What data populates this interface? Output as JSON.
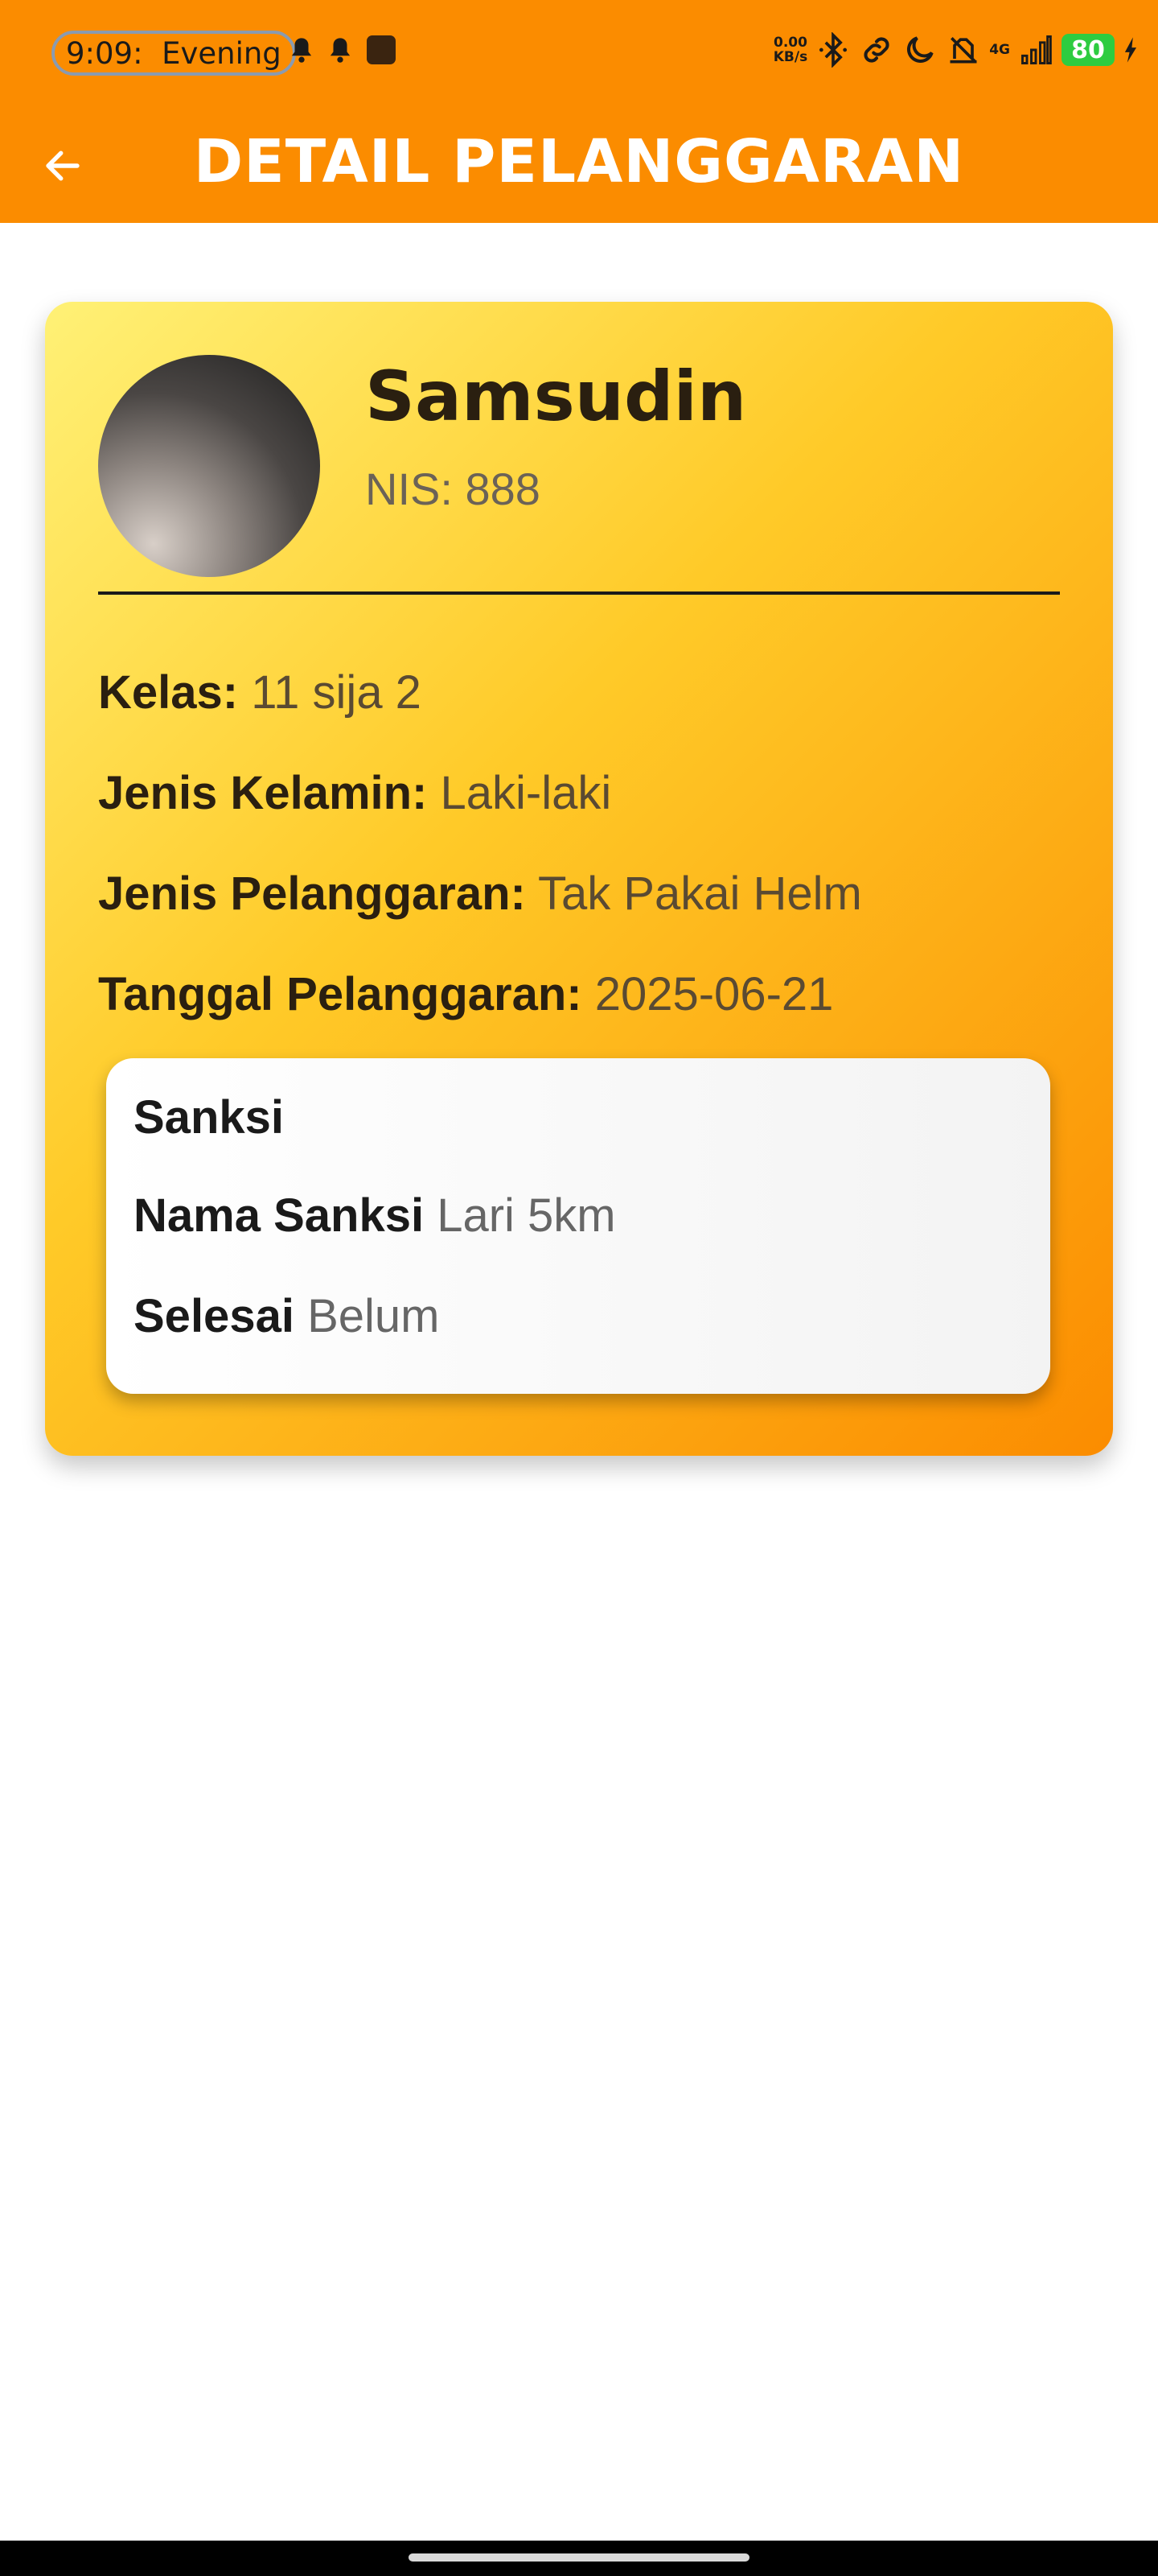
{
  "status_bar": {
    "time": "9:09:",
    "time_label": "Evening",
    "net_speed_top": "0.00",
    "net_speed_bottom": "KB/s",
    "network_type": "4G",
    "battery": "80",
    "icons": [
      "bell-icon",
      "bell-icon",
      "app-icon",
      "bluetooth-icon",
      "link-icon",
      "moon-icon",
      "vibrate-off-icon",
      "signal-icon",
      "battery-icon",
      "charging-icon"
    ]
  },
  "appbar": {
    "title": "DETAIL PELANGGARAN",
    "back_icon": "arrow-left-icon",
    "background": "#fb8c00"
  },
  "student": {
    "name": "Samsudin",
    "nis": "NIS: 888"
  },
  "details": [
    {
      "label": "Kelas:",
      "value": "11 sija 2"
    },
    {
      "label": "Jenis Kelamin:",
      "value": "Laki-laki"
    },
    {
      "label": "Jenis Pelanggaran:",
      "value": "Tak Pakai Helm"
    },
    {
      "label": "Tanggal Pelanggaran:",
      "value": "2025-06-21"
    }
  ],
  "sanksi": {
    "title": "Sanksi",
    "rows": [
      {
        "label": "Nama Sanksi",
        "value": "Lari 5km"
      },
      {
        "label": "Selesai",
        "value": "Belum"
      }
    ]
  },
  "colors": {
    "accent": "#fb8c00",
    "card_gradient_start": "#fff176",
    "card_gradient_end": "#fb8c00"
  }
}
